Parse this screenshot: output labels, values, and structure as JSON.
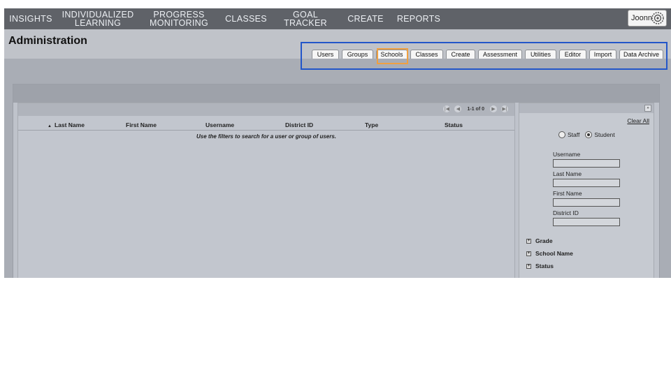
{
  "nav": {
    "items": [
      {
        "lines": [
          "INSIGHTS"
        ]
      },
      {
        "lines": [
          "INDIVIDUALIZED",
          "LEARNING"
        ]
      },
      {
        "lines": [
          "PROGRESS",
          "MONITORING"
        ]
      },
      {
        "lines": [
          "CLASSES"
        ]
      },
      {
        "lines": [
          "GOAL TRACKER"
        ]
      },
      {
        "lines": [
          "CREATE"
        ]
      },
      {
        "lines": [
          "REPORTS"
        ]
      }
    ],
    "user_name": "Joonn"
  },
  "page": {
    "title": "Administration"
  },
  "tabs": [
    "Users",
    "Groups",
    "Schools",
    "Classes",
    "Create",
    "Assessment",
    "Utilities",
    "Editor",
    "Import",
    "Data Archive"
  ],
  "grid": {
    "pager": "1-1 of 0",
    "columns": [
      "Last Name",
      "First Name",
      "Username",
      "District ID",
      "Type",
      "Status"
    ],
    "empty_message": "Use the filters to search for a user or group of users."
  },
  "filter": {
    "clear_all": "Clear All",
    "radio_staff": "Staff",
    "radio_student": "Student",
    "selected": "Student",
    "fields": {
      "username": "Username",
      "last_name": "Last Name",
      "first_name": "First Name",
      "district_id": "District ID"
    },
    "expanders": [
      "Grade",
      "School Name",
      "Status"
    ]
  },
  "colors": {
    "highlight_blue": "#2356c9",
    "highlight_orange": "#f0a040",
    "nav_bg": "#5f6268"
  }
}
